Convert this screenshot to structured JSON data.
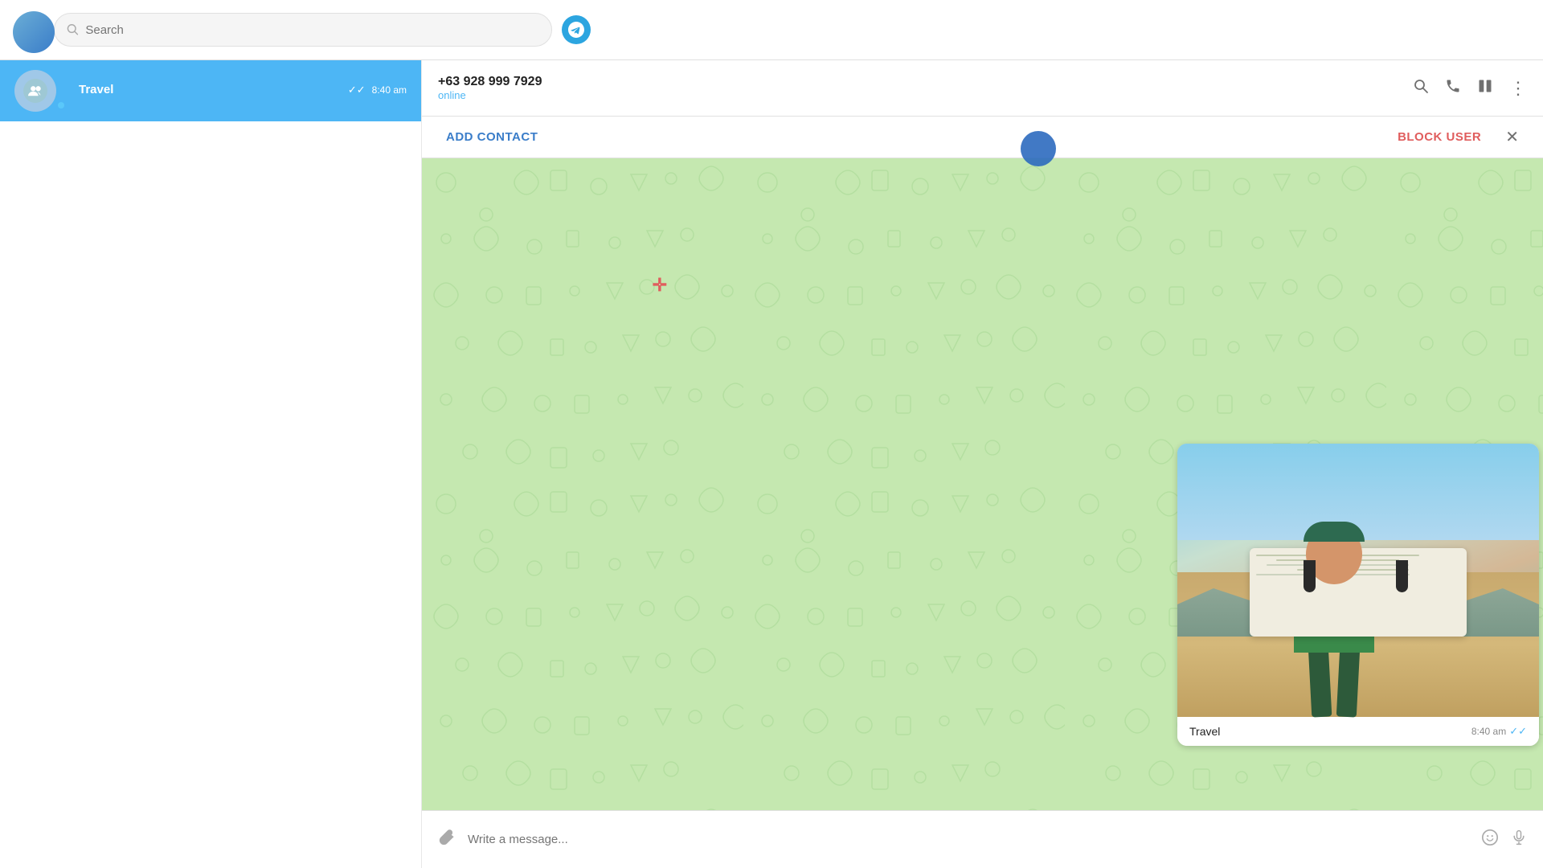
{
  "app": {
    "title": "Telegram"
  },
  "topbar": {
    "search_placeholder": "Search",
    "logo_alt": "Telegram"
  },
  "header": {
    "phone": "+63 928 999 7929",
    "status": "online",
    "actions": {
      "search": "🔍",
      "call": "📞",
      "columns": "⊞",
      "more": "⋮"
    }
  },
  "action_bar": {
    "add_contact": "ADD CONTACT",
    "block_user": "BLOCK USER",
    "close": "✕"
  },
  "chat_list": [
    {
      "name": "Travel",
      "time": "8:40 am",
      "preview": "",
      "checked": true
    }
  ],
  "message": {
    "caption": "Travel",
    "time": "8:40 am",
    "checked": true
  },
  "input": {
    "placeholder": "Write a message..."
  },
  "colors": {
    "accent": "#2ca5e0",
    "online": "#4db6f5",
    "selected_bg": "#4db6f5",
    "chat_bg": "#c5e8b0",
    "add_contact": "#3a7dc9",
    "block_user": "#e05d5d"
  }
}
